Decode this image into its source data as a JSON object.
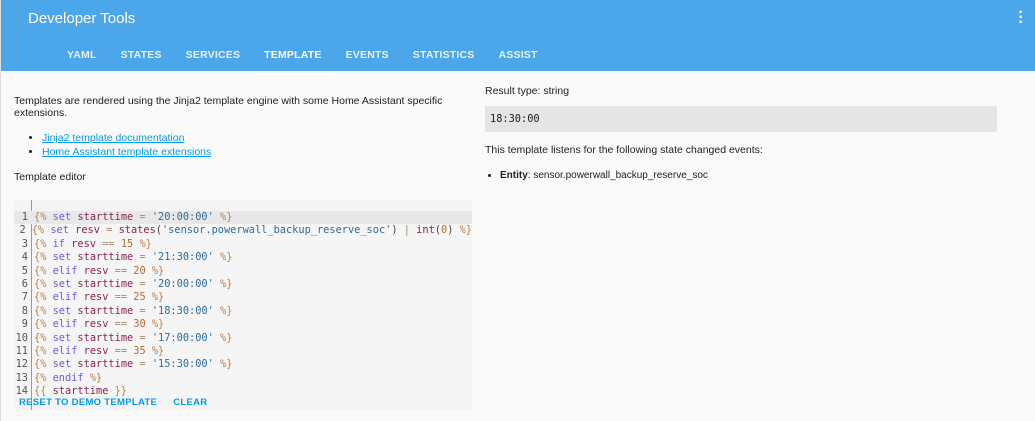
{
  "header": {
    "title": "Developer Tools",
    "tabs": [
      "YAML",
      "STATES",
      "SERVICES",
      "TEMPLATE",
      "EVENTS",
      "STATISTICS",
      "ASSIST"
    ],
    "active_tab": "TEMPLATE"
  },
  "left": {
    "intro": "Templates are rendered using the Jinja2 template engine with some Home Assistant specific extensions.",
    "links": [
      "Jinja2 template documentation",
      "Home Assistant template extensions"
    ],
    "editor_label": "Template editor",
    "code": [
      "{% set starttime = '20:00:00' %}",
      "{% set resv = states('sensor.powerwall_backup_reserve_soc') | int(0) %}",
      "{% if resv == 15 %}",
      "{% set starttime = '21:30:00' %}",
      "{% elif resv == 20 %}",
      "{% set starttime = '20:00:00' %}",
      "{% elif resv == 25 %}",
      "{% set starttime = '18:30:00' %}",
      "{% elif resv == 30 %}",
      "{% set starttime = '17:00:00' %}",
      "{% elif resv == 35 %}",
      "{% set starttime = '15:30:00' %}",
      "{% endif %}",
      "{{ starttime }}"
    ],
    "buttons": {
      "reset": "RESET TO DEMO TEMPLATE",
      "clear": "CLEAR"
    }
  },
  "right": {
    "result_type": "Result type: string",
    "result": "18:30:00",
    "listen_text": "This template listens for the following state changed events:",
    "entity_label": "Entity",
    "entity_value": ": sensor.powerwall_backup_reserve_soc"
  }
}
